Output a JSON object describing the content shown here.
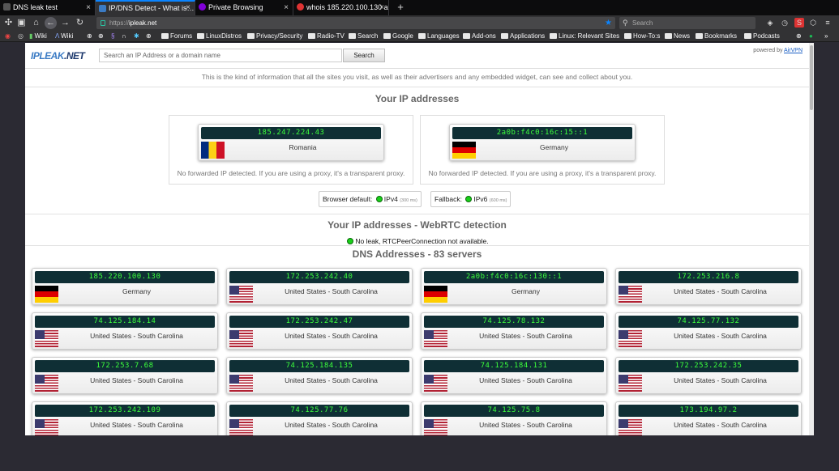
{
  "tabs": [
    {
      "label": "DNS leak test",
      "icon": "globe-icon"
    },
    {
      "label": "IP/DNS Detect - What is…",
      "icon": "ipleak-icon"
    },
    {
      "label": "Private Browsing",
      "icon": "private-browsing-icon"
    },
    {
      "label": "whois 185.220.100.130 a…",
      "icon": "whois-icon"
    }
  ],
  "url": {
    "proto": "https://",
    "host": "ipleak.net"
  },
  "search_placeholder": "Search",
  "bookmarks": [
    "Wiki",
    "Wiki",
    "Forums",
    "LinuxDistros",
    "Privacy/Security",
    "Radio-TV",
    "Search",
    "Google",
    "Languages",
    "Add-ons",
    "Applications",
    "Linux: Relevant Sites",
    "How-To:s",
    "News",
    "Bookmarks",
    "Podcasts"
  ],
  "site": {
    "logo_a": "IPLEAK",
    "logo_b": ".NET",
    "search_placeholder": "Search an IP Address or a domain name",
    "search_button": "Search",
    "powered_by": "powered by ",
    "powered_link": "AirVPN",
    "intro": "This is the kind of information that all the sites you visit, as well as their advertisers and any embedded widget, can see and collect about you.",
    "h_ip": "Your IP addresses",
    "ips": [
      {
        "ip": "185.247.224.43",
        "country": "Romania",
        "flag": "ro",
        "note": "No forwarded IP detected. If you are using a proxy, it's a transparent proxy."
      },
      {
        "ip": "2a0b:f4c0:16c:15::1",
        "country": "Germany",
        "flag": "de",
        "note": "No forwarded IP detected. If you are using a proxy, it's a transparent proxy."
      }
    ],
    "browser_default_label": "Browser default:",
    "browser_default_proto": "IPv4",
    "browser_default_ms": "(300 ms)",
    "fallback_label": "Fallback:",
    "fallback_proto": "IPv6",
    "fallback_ms": "(600 ms)",
    "h_webrtc": "Your IP addresses - WebRTC detection",
    "webrtc_status": "No leak, RTCPeerConnection not available.",
    "h_dns": "DNS Addresses - 83 servers",
    "dns": [
      {
        "ip": "185.220.100.130",
        "country": "Germany",
        "flag": "de"
      },
      {
        "ip": "172.253.242.40",
        "country": "United States - South Carolina",
        "flag": "us"
      },
      {
        "ip": "2a0b:f4c0:16c:130::1",
        "country": "Germany",
        "flag": "de"
      },
      {
        "ip": "172.253.216.8",
        "country": "United States - South Carolina",
        "flag": "us"
      },
      {
        "ip": "74.125.184.14",
        "country": "United States - South Carolina",
        "flag": "us"
      },
      {
        "ip": "172.253.242.47",
        "country": "United States - South Carolina",
        "flag": "us"
      },
      {
        "ip": "74.125.78.132",
        "country": "United States - South Carolina",
        "flag": "us"
      },
      {
        "ip": "74.125.77.132",
        "country": "United States - South Carolina",
        "flag": "us"
      },
      {
        "ip": "172.253.7.68",
        "country": "United States - South Carolina",
        "flag": "us"
      },
      {
        "ip": "74.125.184.135",
        "country": "United States - South Carolina",
        "flag": "us"
      },
      {
        "ip": "74.125.184.131",
        "country": "United States - South Carolina",
        "flag": "us"
      },
      {
        "ip": "172.253.242.35",
        "country": "United States - South Carolina",
        "flag": "us"
      },
      {
        "ip": "172.253.242.109",
        "country": "United States - South Carolina",
        "flag": "us"
      },
      {
        "ip": "74.125.77.76",
        "country": "United States - South Carolina",
        "flag": "us"
      },
      {
        "ip": "74.125.75.8",
        "country": "United States - South Carolina",
        "flag": "us"
      },
      {
        "ip": "173.194.97.2",
        "country": "United States - South Carolina",
        "flag": "us"
      }
    ]
  }
}
